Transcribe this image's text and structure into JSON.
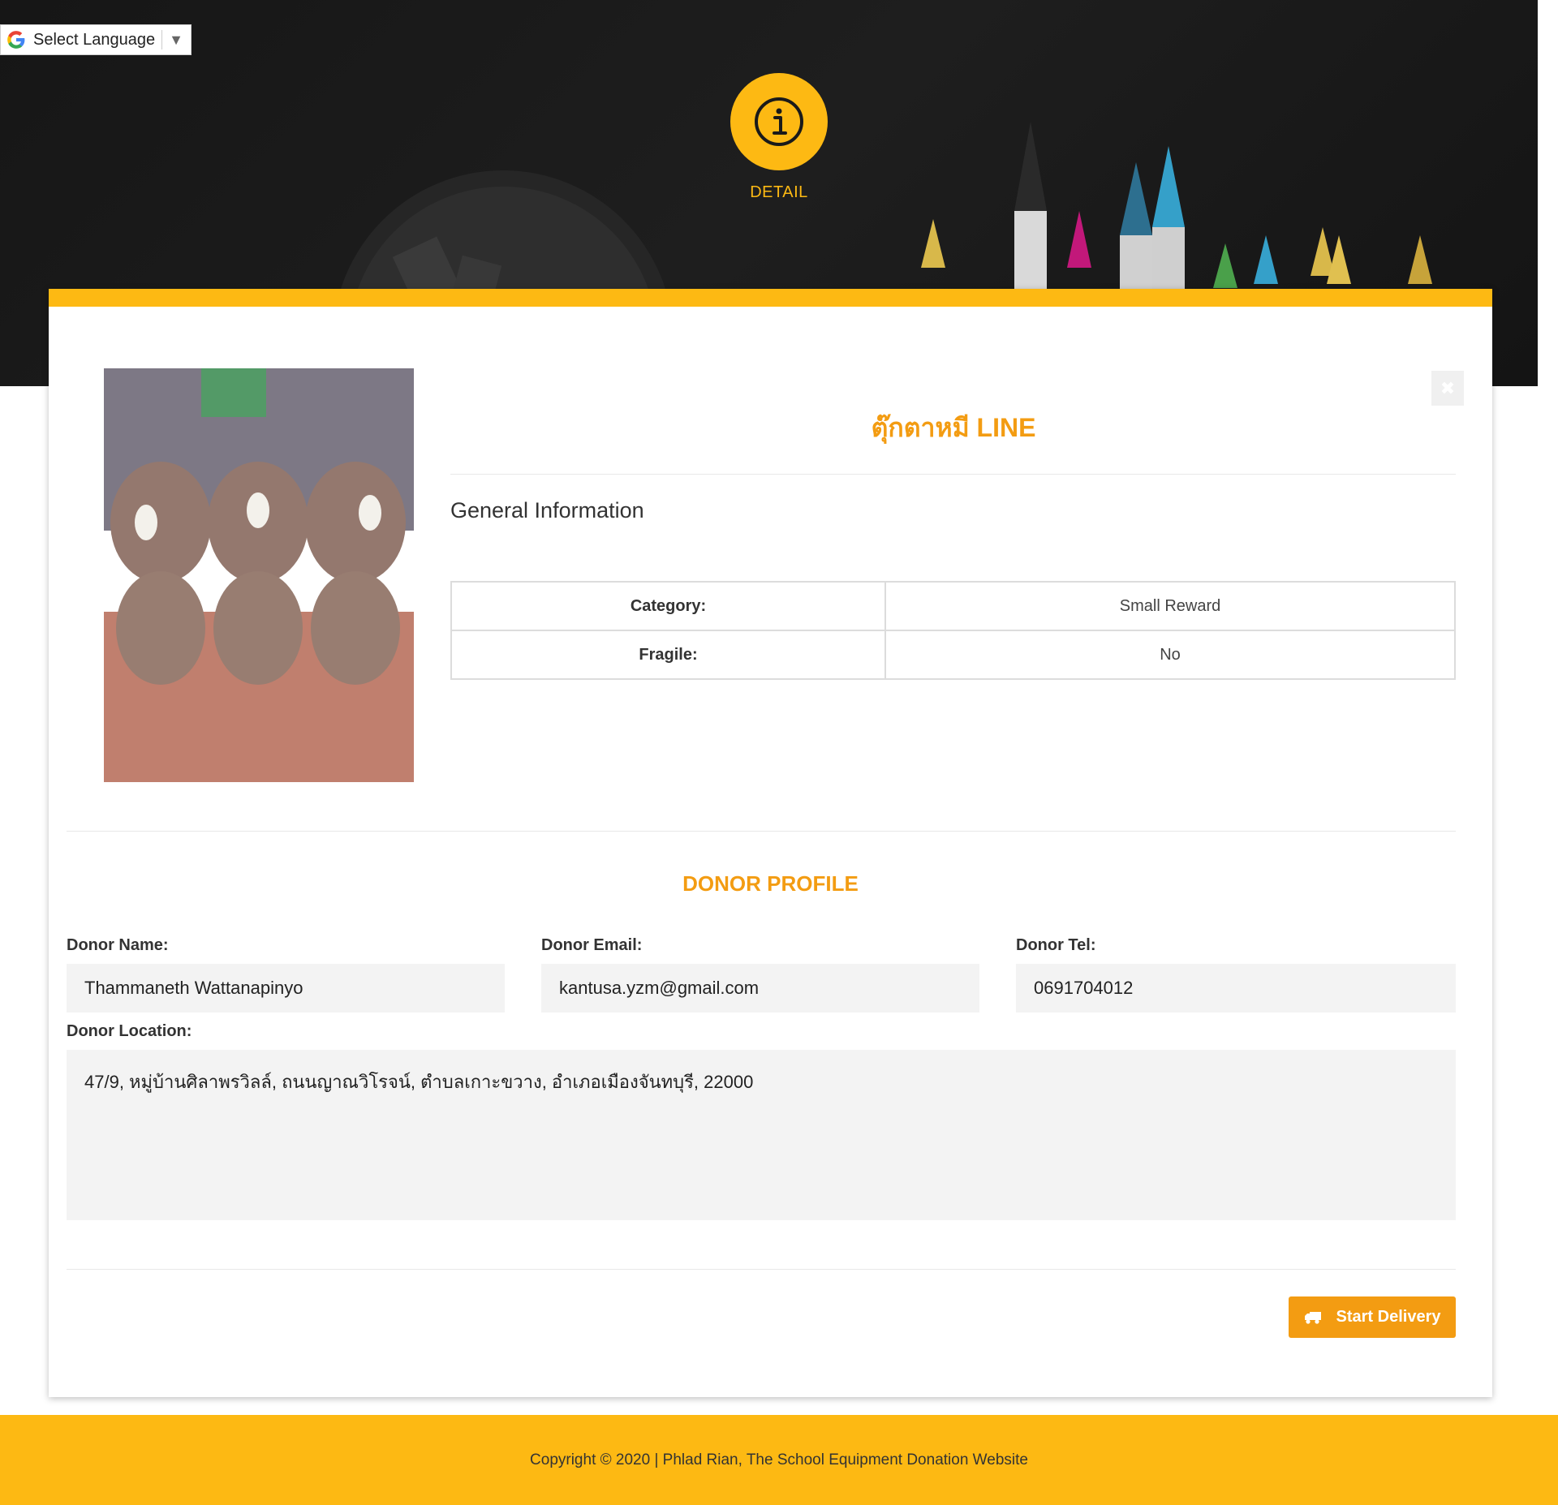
{
  "language_widget": {
    "label": "Select Language",
    "arrow": "▼",
    "icon": "google-g-icon"
  },
  "header": {
    "badge_icon": "info-icon",
    "label": "DETAIL"
  },
  "item": {
    "title": "ตุ๊กตาหมี LINE",
    "section_heading": "General Information",
    "info": [
      {
        "key": "Category:",
        "value": "Small Reward"
      },
      {
        "key": "Fragile:",
        "value": "No"
      }
    ]
  },
  "donor": {
    "heading": "DONOR PROFILE",
    "name_label": "Donor Name:",
    "name": "Thammaneth Wattanapinyo",
    "email_label": "Donor Email:",
    "email": "kantusa.yzm@gmail.com",
    "tel_label": "Donor Tel:",
    "tel": "0691704012",
    "location_label": "Donor Location:",
    "location": "47/9, หมู่บ้านศิลาพรวิลล์, ถนนญาณวิโรจน์, ตำบลเกาะขวาง, อำเภอเมืองจันทบุรี, 22000"
  },
  "actions": {
    "start_delivery_label": "Start Delivery",
    "close_icon": "close-icon",
    "truck_icon": "truck-icon"
  },
  "footer": {
    "copyright": "Copyright © 2020 | Phlad Rian, The School Equipment Donation Website"
  },
  "colors": {
    "accent": "#fdb913",
    "title_orange": "#f39c12",
    "hero_bg": "#1a1a1a"
  }
}
